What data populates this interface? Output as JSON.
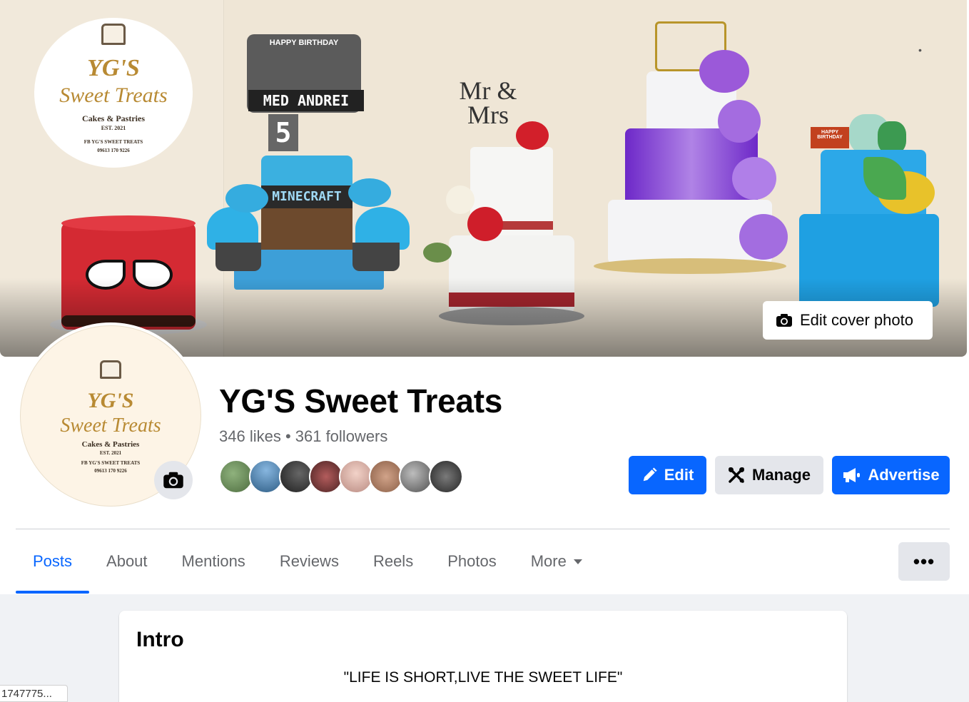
{
  "cover": {
    "edit_cover_label": "Edit cover photo",
    "logo": {
      "line1": "YG'S",
      "line2": "Sweet Treats",
      "line3": "Cakes & Pastries",
      "line4": "EST. 2021",
      "line5": "FB YG'S SWEET TREATS",
      "line6": "09613 170 9226"
    },
    "topper_birthday": "HAPPY BIRTHDAY",
    "topper_name": "MED ANDREI",
    "topper_age": "5",
    "band_text": "MINECRAFT",
    "topper_mr": "Mr & Mrs",
    "dino_sign": "HAPPY BIRTHDAY"
  },
  "profile": {
    "name": "YG'S Sweet Treats",
    "stats": "346 likes • 361 followers"
  },
  "followers": [
    {
      "color": "#6a8d5a"
    },
    {
      "color": "#3d6f97"
    },
    {
      "color": "#2a2a2a"
    },
    {
      "color": "#7a3a3a"
    },
    {
      "color": "#d9b3a9"
    },
    {
      "color": "#b08066"
    },
    {
      "color": "#777777"
    },
    {
      "color": "#3f3f3f"
    }
  ],
  "actions": {
    "edit_label": "Edit",
    "manage_label": "Manage",
    "advertise_label": "Advertise"
  },
  "tabs": [
    {
      "label": "Posts",
      "active": true
    },
    {
      "label": "About"
    },
    {
      "label": "Mentions"
    },
    {
      "label": "Reviews"
    },
    {
      "label": "Reels"
    },
    {
      "label": "Photos"
    },
    {
      "label": "More"
    }
  ],
  "more_options_label": "•••",
  "intro": {
    "title": "Intro",
    "bio": "\"LIFE IS SHORT,LIVE THE SWEET LIFE\""
  },
  "status_bar": "1747775...",
  "colors": {
    "accent": "#0866ff",
    "secondary_button": "#e4e6eb",
    "page_bg": "#f0f2f5"
  }
}
